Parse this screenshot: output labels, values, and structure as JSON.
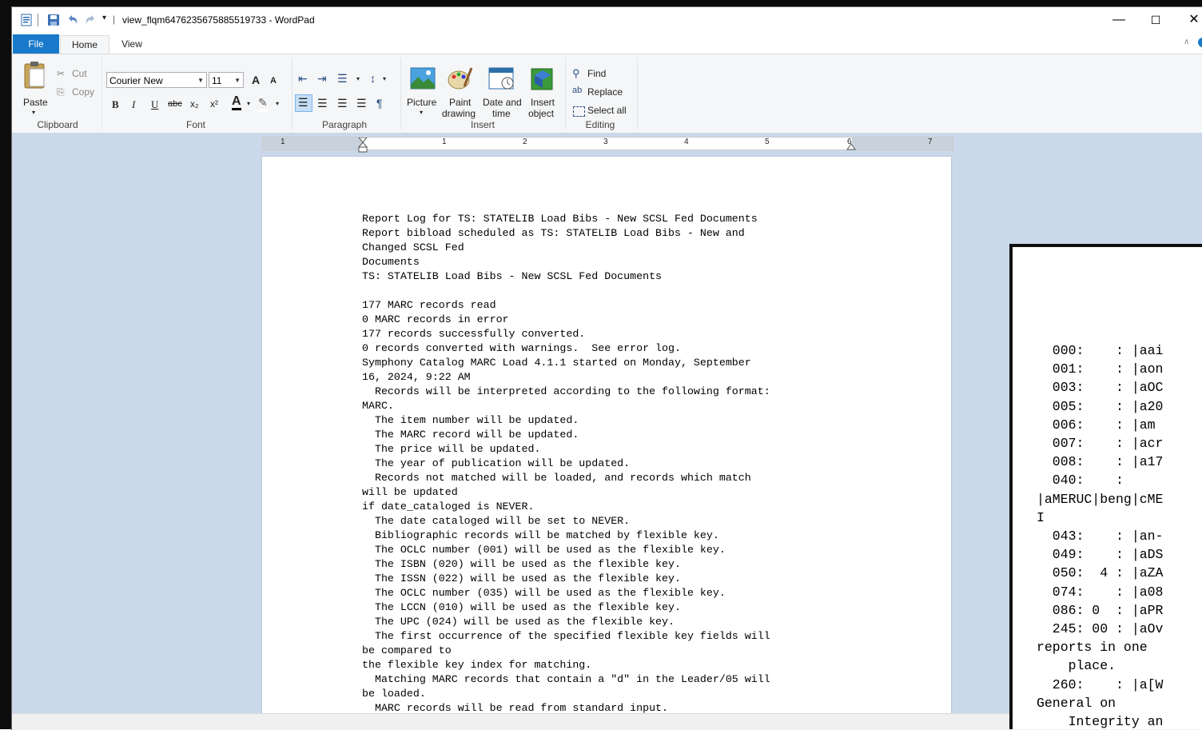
{
  "window": {
    "title": "view_flqm6476235675885519733 - WordPad",
    "qat_separator": "|",
    "minimize": "—",
    "maximize": "☐",
    "close": "✕"
  },
  "tabs": [
    {
      "label": "File"
    },
    {
      "label": "Home"
    },
    {
      "label": "View"
    }
  ],
  "ribbon": {
    "clipboard": {
      "label": "Clipboard",
      "paste": "Paste",
      "cut": "Cut",
      "copy": "Copy"
    },
    "font": {
      "label": "Font",
      "family": "Courier New",
      "size": "11",
      "bold": "B",
      "italic": "I",
      "underline": "U",
      "strike": "abc",
      "subscript": "x₂",
      "superscript": "x²",
      "grow": "A",
      "shrink": "A",
      "color": "A"
    },
    "paragraph": {
      "label": "Paragraph"
    },
    "insert": {
      "label": "Insert",
      "picture": "Picture",
      "paint1": "Paint",
      "paint2": "drawing",
      "datetime1": "Date and",
      "datetime2": "time",
      "object1": "Insert",
      "object2": "object"
    },
    "editing": {
      "label": "Editing",
      "find": "Find",
      "replace": "Replace",
      "select_all": "Select all"
    }
  },
  "ruler": {
    "marks": [
      "1",
      "1",
      "2",
      "3",
      "4",
      "5",
      "6",
      "7"
    ]
  },
  "document": {
    "lines": [
      "Report Log for TS: STATELIB Load Bibs - New SCSL Fed Documents",
      "Report bibload scheduled as TS: STATELIB Load Bibs - New and",
      "Changed SCSL Fed",
      "Documents",
      "TS: STATELIB Load Bibs - New SCSL Fed Documents",
      "",
      "177 MARC records read",
      "0 MARC records in error",
      "177 records successfully converted.",
      "0 records converted with warnings.  See error log.",
      "Symphony Catalog MARC Load 4.1.1 started on Monday, September",
      "16, 2024, 9:22 AM",
      "  Records will be interpreted according to the following format:",
      "MARC.",
      "  The item number will be updated.",
      "  The MARC record will be updated.",
      "  The price will be updated.",
      "  The year of publication will be updated.",
      "  Records not matched will be loaded, and records which match",
      "will be updated",
      "if date_cataloged is NEVER.",
      "  The date cataloged will be set to NEVER.",
      "  Bibliographic records will be matched by flexible key.",
      "  The OCLC number (001) will be used as the flexible key.",
      "  The ISBN (020) will be used as the flexible key.",
      "  The ISSN (022) will be used as the flexible key.",
      "  The OCLC number (035) will be used as the flexible key.",
      "  The LCCN (010) will be used as the flexible key.",
      "  The UPC (024) will be used as the flexible key.",
      "  The first occurrence of the specified flexible key fields will",
      "be compared to",
      "the flexible key index for matching.",
      "  Matching MARC records that contain a \"d\" in the Leader/05 will",
      "be loaded.",
      "  MARC records will be read from standard input."
    ]
  },
  "second_window": {
    "lines": [
      "  000:    : |aai",
      "  001:    : |aon",
      "  003:    : |aOC",
      "  005:    : |a20",
      "  006:    : |am ",
      "  007:    : |acr",
      "  008:    : |a17",
      "  040:    :",
      "|aMERUC|beng|cME",
      "I",
      "  043:    : |an-",
      "  049:    : |aDS",
      "  050:  4 : |aZA",
      "  074:    : |a08",
      "  086: 0  : |aPR",
      "  245: 00 : |aOv",
      "reports in one",
      "    place.",
      "  260:    : |a[W",
      "General on",
      "    Integrity an"
    ]
  }
}
